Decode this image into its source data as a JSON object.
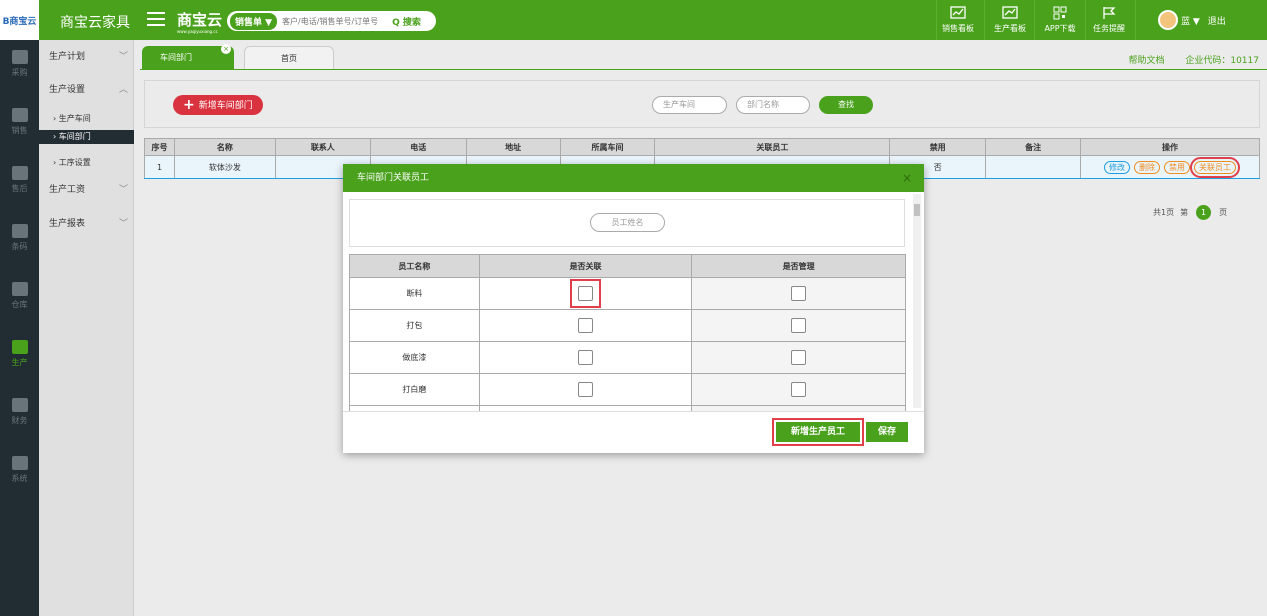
{
  "app": {
    "logo_text": "B商宝云",
    "brand": "商宝云家具",
    "brand_logo": "商宝云",
    "brand_logo_sub": "www.yaqiyuxiang.cc"
  },
  "search": {
    "dropdown_label": "销售单 ▼",
    "placeholder": "客户/电话/销售单号/订单号",
    "button_label": "Q 搜索"
  },
  "toolbar": [
    {
      "label": "销售看板",
      "icon": "chart-board-icon"
    },
    {
      "label": "生产看板",
      "icon": "production-board-icon"
    },
    {
      "label": "APP下载",
      "icon": "qr-code-icon"
    },
    {
      "label": "任务提醒",
      "icon": "flag-icon"
    }
  ],
  "user": {
    "name": "蓝 ▼",
    "logout": "退出"
  },
  "leftnav": [
    {
      "label": "采购"
    },
    {
      "label": "销售"
    },
    {
      "label": "售后"
    },
    {
      "label": "条码"
    },
    {
      "label": "仓库"
    },
    {
      "label": "生产",
      "active": true
    },
    {
      "label": "财务"
    },
    {
      "label": "系统"
    }
  ],
  "subnav": {
    "plan": "生产计划",
    "settings": "生产设置",
    "items": [
      "› 生产车间",
      "› 车间部门",
      "› 工序设置"
    ],
    "wages": "生产工资",
    "reports": "生产报表"
  },
  "tabs": {
    "active": "车间部门",
    "close": "×",
    "home": "首页"
  },
  "toplinks": {
    "help": "帮助文档",
    "company_code": "企业代码：10117"
  },
  "filter": {
    "add_button": "新增车间部门",
    "workshop_placeholder": "生产车间",
    "dept_placeholder": "部门名称",
    "search_button": "查找"
  },
  "table": {
    "headers": [
      "序号",
      "名称",
      "联系人",
      "电话",
      "地址",
      "所属车间",
      "关联员工",
      "禁用",
      "备注",
      "操作"
    ],
    "rows": [
      {
        "no": "1",
        "name": "软体沙发",
        "contact": "",
        "phone": "",
        "address": "",
        "workshop": "",
        "employees": "",
        "disabled": "否",
        "remark": ""
      }
    ],
    "ops": [
      "修改",
      "删除",
      "禁用",
      "关联员工"
    ]
  },
  "pager": {
    "total": "共1页",
    "prefix": "第",
    "current": "1",
    "suffix": "页"
  },
  "modal": {
    "title": "车间部门关联员工",
    "close": "×",
    "search_placeholder": "员工姓名",
    "headers": [
      "员工名称",
      "是否关联",
      "是否管理"
    ],
    "employees": [
      "断料",
      "打包",
      "做底漆",
      "打白磨"
    ],
    "add_button": "新增生产员工",
    "save_button": "保存"
  }
}
